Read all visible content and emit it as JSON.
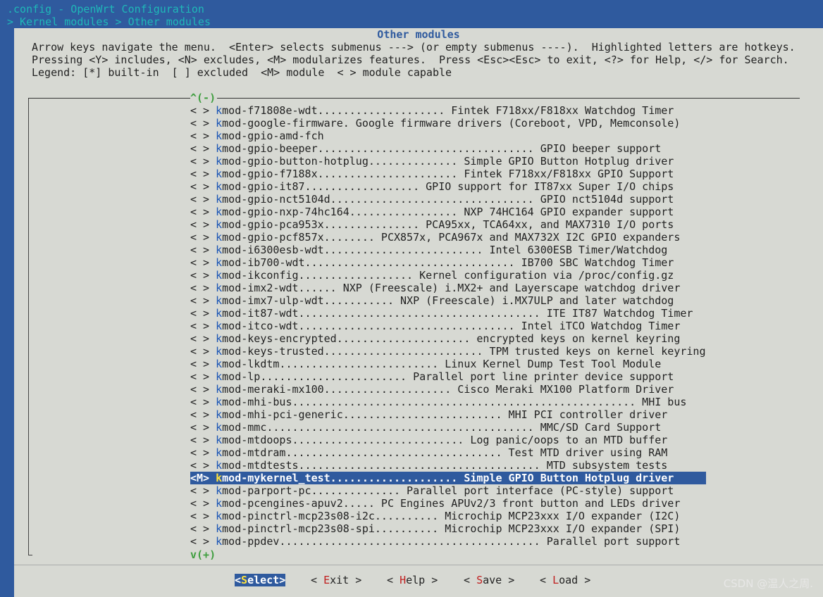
{
  "window": {
    "title": ".config - OpenWrt Configuration",
    "breadcrumb": "> Kernel modules > Other modules"
  },
  "dialog": {
    "title": "Other modules",
    "help_lines": [
      "Arrow keys navigate the menu.  <Enter> selects submenus ---> (or empty submenus ----).  Highlighted letters are hotkeys.",
      "Pressing <Y> includes, <N> excludes, <M> modularizes features.  Press <Esc><Esc> to exit, <?> for Help, </> for Search.",
      "Legend: [*] built-in  [ ] excluded  <M> module  < > module capable"
    ],
    "scroll_up": "^(-)",
    "scroll_down": "v(+)"
  },
  "menu": {
    "items": [
      {
        "state": "< >",
        "hot": "k",
        "rest": "mod-f71808e-wdt.................... Fintek F718xx/F818xx Watchdog Timer",
        "selected": false
      },
      {
        "state": "< >",
        "hot": "k",
        "rest": "mod-google-firmware. Google firmware drivers (Coreboot, VPD, Memconsole)",
        "selected": false
      },
      {
        "state": "< >",
        "hot": "k",
        "rest": "mod-gpio-amd-fch",
        "selected": false
      },
      {
        "state": "< >",
        "hot": "k",
        "rest": "mod-gpio-beeper.................................. GPIO beeper support",
        "selected": false
      },
      {
        "state": "< >",
        "hot": "k",
        "rest": "mod-gpio-button-hotplug.............. Simple GPIO Button Hotplug driver",
        "selected": false
      },
      {
        "state": "< >",
        "hot": "k",
        "rest": "mod-gpio-f7188x...................... Fintek F718xx/F818xx GPIO Support",
        "selected": false
      },
      {
        "state": "< >",
        "hot": "k",
        "rest": "mod-gpio-it87.................. GPIO support for IT87xx Super I/O chips",
        "selected": false
      },
      {
        "state": "< >",
        "hot": "k",
        "rest": "mod-gpio-nct5104d................................ GPIO nct5104d support",
        "selected": false
      },
      {
        "state": "< >",
        "hot": "k",
        "rest": "mod-gpio-nxp-74hc164................. NXP 74HC164 GPIO expander support",
        "selected": false
      },
      {
        "state": "< >",
        "hot": "k",
        "rest": "mod-gpio-pca953x............... PCA95xx, TCA64xx, and MAX7310 I/O ports",
        "selected": false
      },
      {
        "state": "< >",
        "hot": "k",
        "rest": "mod-gpio-pcf857x........ PCX857x, PCA967x and MAX732X I2C GPIO expanders",
        "selected": false
      },
      {
        "state": "< >",
        "hot": "k",
        "rest": "mod-i6300esb-wdt......................... Intel 6300ESB Timer/Watchdog",
        "selected": false
      },
      {
        "state": "< >",
        "hot": "k",
        "rest": "mod-ib700-wdt................................. IB700 SBC Watchdog Timer",
        "selected": false
      },
      {
        "state": "< >",
        "hot": "k",
        "rest": "mod-ikconfig.................. Kernel configuration via /proc/config.gz",
        "selected": false
      },
      {
        "state": "< >",
        "hot": "k",
        "rest": "mod-imx2-wdt...... NXP (Freescale) i.MX2+ and Layerscape watchdog driver",
        "selected": false
      },
      {
        "state": "< >",
        "hot": "k",
        "rest": "mod-imx7-ulp-wdt........... NXP (Freescale) i.MX7ULP and later watchdog",
        "selected": false
      },
      {
        "state": "< >",
        "hot": "k",
        "rest": "mod-it87-wdt...................................... ITE IT87 Watchdog Timer",
        "selected": false
      },
      {
        "state": "< >",
        "hot": "k",
        "rest": "mod-itco-wdt.................................. Intel iTCO Watchdog Timer",
        "selected": false
      },
      {
        "state": "< >",
        "hot": "k",
        "rest": "mod-keys-encrypted..................... encrypted keys on kernel keyring",
        "selected": false
      },
      {
        "state": "< >",
        "hot": "k",
        "rest": "mod-keys-trusted......................... TPM trusted keys on kernel keyring",
        "selected": false
      },
      {
        "state": "< >",
        "hot": "k",
        "rest": "mod-lkdtm......................... Linux Kernel Dump Test Tool Module",
        "selected": false
      },
      {
        "state": "< >",
        "hot": "k",
        "rest": "mod-lp....................... Parallel port line printer device support",
        "selected": false
      },
      {
        "state": "< >",
        "hot": "k",
        "rest": "mod-meraki-mx100.................... Cisco Meraki MX100 Platform Driver",
        "selected": false
      },
      {
        "state": "< >",
        "hot": "k",
        "rest": "mod-mhi-bus...................................................... MHI bus",
        "selected": false
      },
      {
        "state": "< >",
        "hot": "k",
        "rest": "mod-mhi-pci-generic......................... MHI PCI controller driver",
        "selected": false
      },
      {
        "state": "< >",
        "hot": "k",
        "rest": "mod-mmc.......................................... MMC/SD Card Support",
        "selected": false
      },
      {
        "state": "< >",
        "hot": "k",
        "rest": "mod-mtdoops........................... Log panic/oops to an MTD buffer",
        "selected": false
      },
      {
        "state": "< >",
        "hot": "k",
        "rest": "mod-mtdram.................................. Test MTD driver using RAM",
        "selected": false
      },
      {
        "state": "< >",
        "hot": "k",
        "rest": "mod-mtdtests...................................... MTD subsystem tests",
        "selected": false
      },
      {
        "state": "<M>",
        "hot": "k",
        "rest": "mod-mykernel_test.................... Simple GPIO Button Hotplug driver",
        "selected": true
      },
      {
        "state": "< >",
        "hot": "k",
        "rest": "mod-parport-pc.............. Parallel port interface (PC-style) support",
        "selected": false
      },
      {
        "state": "< >",
        "hot": "k",
        "rest": "mod-pcengines-apuv2..... PC Engines APUv2/3 front button and LEDs driver",
        "selected": false
      },
      {
        "state": "< >",
        "hot": "k",
        "rest": "mod-pinctrl-mcp23s08-i2c.......... Microchip MCP23xxx I/O expander (I2C)",
        "selected": false
      },
      {
        "state": "< >",
        "hot": "k",
        "rest": "mod-pinctrl-mcp23s08-spi.......... Microchip MCP23xxx I/O expander (SPI)",
        "selected": false
      },
      {
        "state": "< >",
        "hot": "k",
        "rest": "mod-ppdev......................................... Parallel port support",
        "selected": false
      }
    ]
  },
  "buttons": {
    "select": {
      "pre": "<",
      "hk": "S",
      "post": "elect>"
    },
    "exit": {
      "pre": "< ",
      "hk": "E",
      "post": "xit >"
    },
    "help": {
      "pre": "< ",
      "hk": "H",
      "post": "elp >"
    },
    "save": {
      "pre": "< ",
      "hk": "S",
      "post": "ave >"
    },
    "load": {
      "pre": "< ",
      "hk": "L",
      "post": "oad >"
    }
  },
  "watermark": "CSDN @温人之周."
}
